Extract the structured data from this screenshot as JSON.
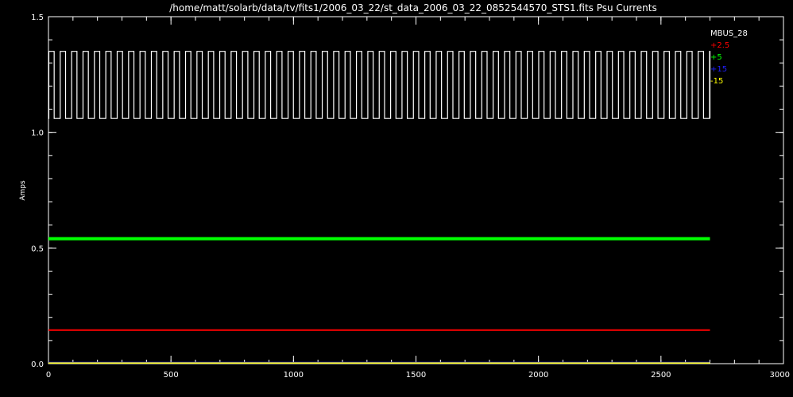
{
  "chart_data": {
    "type": "line",
    "title": "/home/matt/solarb/data/tv/fits1/2006_03_22/st_data_2006_03_22_0852544570_STS1.fits Psu Currents",
    "ylabel": "Amps",
    "xlabel": "",
    "xlim": [
      0,
      3000
    ],
    "ylim": [
      0.0,
      1.5
    ],
    "x_ticks": [
      0,
      500,
      1000,
      1500,
      2000,
      2500,
      3000
    ],
    "x_tick_labels": [
      "0",
      "500",
      "1000",
      "1500",
      "2000",
      "2500",
      "3000"
    ],
    "y_ticks": [
      0.0,
      0.5,
      1.0,
      1.5
    ],
    "y_tick_labels": [
      "0.0",
      "0.5",
      "1.0",
      "1.5"
    ],
    "y_minor_step": 0.1,
    "x_minor_step": 100,
    "legend_position": "top-right",
    "series": [
      {
        "name": "MBUS_28",
        "color": "#ffffff",
        "kind": "square_wave",
        "x_start": 0,
        "x_end": 2700,
        "low": 1.06,
        "high": 1.35,
        "period": 46.5,
        "duty_high": 0.5
      },
      {
        "name": "+2.5",
        "color": "#ff0000",
        "kind": "constant",
        "x_start": 0,
        "x_end": 2700,
        "value": 0.145
      },
      {
        "name": "+5",
        "color": "#00ff00",
        "kind": "constant",
        "x_start": 0,
        "x_end": 2700,
        "value": 0.54
      },
      {
        "name": "+15",
        "color": "#2020ff",
        "kind": "constant",
        "x_start": 0,
        "x_end": 2700,
        "value": 0.005
      },
      {
        "name": "-15",
        "color": "#ffff00",
        "kind": "constant",
        "x_start": 0,
        "x_end": 2700,
        "value": 0.003
      }
    ]
  }
}
